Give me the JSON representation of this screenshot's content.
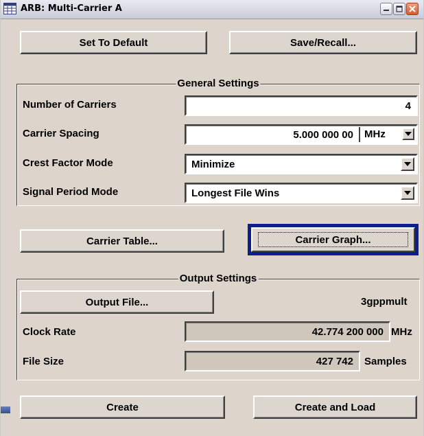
{
  "window": {
    "title": "ARB: Multi-Carrier A",
    "app_icon": "spreadsheet-icon",
    "controls": [
      "minimize-icon",
      "maximize-icon",
      "close-icon"
    ]
  },
  "top_buttons": {
    "set_to_default": "Set To Default",
    "save_recall": "Save/Recall..."
  },
  "general_settings": {
    "title": "General Settings",
    "number_of_carriers": {
      "label": "Number of Carriers",
      "value": "4"
    },
    "carrier_spacing": {
      "label": "Carrier Spacing",
      "value": "5.000 000 00",
      "unit": "MHz"
    },
    "crest_factor_mode": {
      "label": "Crest Factor Mode",
      "value": "Minimize"
    },
    "signal_period_mode": {
      "label": "Signal Period Mode",
      "value": "Longest File Wins"
    }
  },
  "mid_buttons": {
    "carrier_table": "Carrier Table...",
    "carrier_graph": "Carrier Graph..."
  },
  "output_settings": {
    "title": "Output Settings",
    "output_file_button": "Output File...",
    "output_file_name": "3gppmult",
    "clock_rate": {
      "label": "Clock Rate",
      "value": "42.774 200 000",
      "unit": "MHz"
    },
    "file_size": {
      "label": "File Size",
      "value": "427 742",
      "unit": "Samples"
    }
  },
  "bottom_buttons": {
    "create": "Create",
    "create_and_load": "Create and Load"
  },
  "colors": {
    "window_bg": "#ddd5cc",
    "focus_border": "#0a1f8a",
    "readonly_field": "#cfc6bc"
  }
}
